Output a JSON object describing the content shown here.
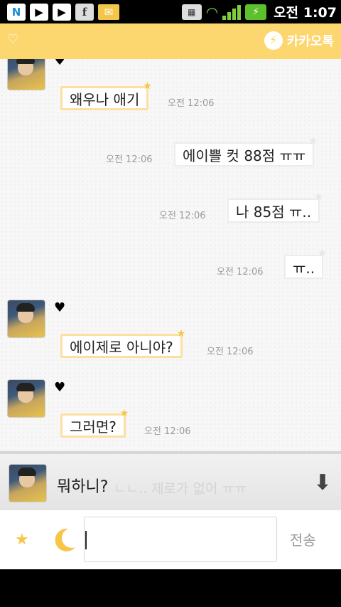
{
  "status_bar": {
    "notification_icons": [
      "naver-icon",
      "play-store-icon",
      "play-store-icon",
      "facebook-icon",
      "mail-icon"
    ],
    "time": "오전 1:07"
  },
  "header": {
    "heart_icon": "heart-outline-icon",
    "brand": "카카오톡",
    "accent": "#fcd66f"
  },
  "messages": [
    {
      "side": "in",
      "text": "왜우나 애기",
      "time": "오전 12:06",
      "show_avatar": false
    },
    {
      "side": "out",
      "text": "에이쁠 컷 88점 ㅠㅠ",
      "time": "오전 12:06"
    },
    {
      "side": "out",
      "text": "나 85점 ㅠ..",
      "time": "오전 12:06"
    },
    {
      "side": "out",
      "text": "ㅠ..",
      "time": "오전 12:06"
    },
    {
      "side": "in",
      "text": "에이제로 아니야?",
      "time": "오전 12:06",
      "show_avatar": true
    },
    {
      "side": "in",
      "text": "그러면?",
      "time": "오전 12:06",
      "show_avatar": true
    }
  ],
  "notification": {
    "text": "뭐하니?",
    "ghost_text": "ㄴㄴ.. 제로가 없어 ㅠㅠ"
  },
  "input_bar": {
    "value": "",
    "send_label": "전송"
  }
}
